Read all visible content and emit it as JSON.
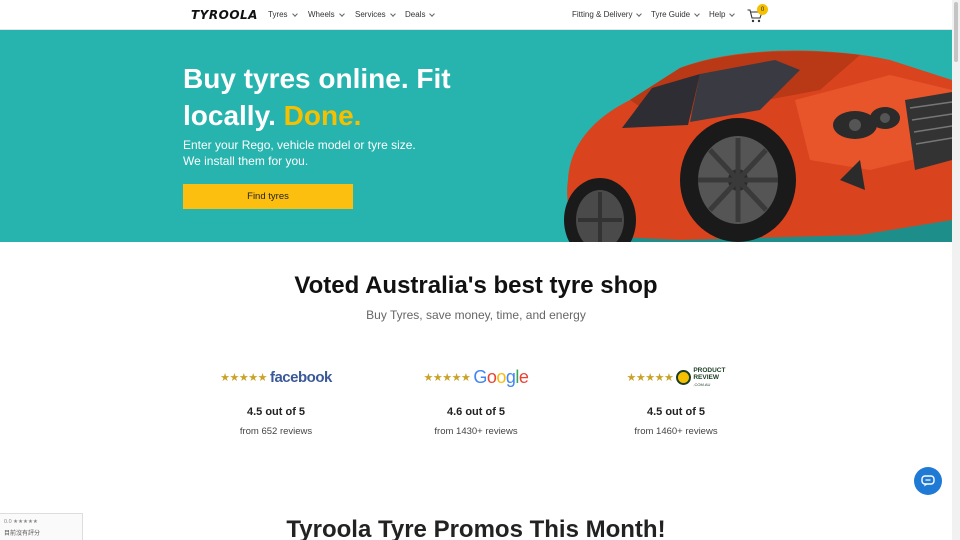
{
  "nav": {
    "logo": "TYROOLA",
    "left_items": [
      "Tyres",
      "Wheels",
      "Services",
      "Deals"
    ],
    "right_items": [
      "Fitting & Delivery",
      "Tyre Guide",
      "Help"
    ],
    "cart_count": "0"
  },
  "hero": {
    "title_line1": "Buy tyres online. Fit",
    "title_line2": "locally.",
    "title_highlight": "Done.",
    "subtitle_line1": "Enter your Rego, vehicle model or tyre size.",
    "subtitle_line2": "We install them for you.",
    "cta": "Find tyres"
  },
  "voted": {
    "title": "Voted Australia's best tyre shop",
    "subtitle": "Buy Tyres, save money, time, and energy"
  },
  "reviews": [
    {
      "platform": "facebook",
      "stars": "★★★★★",
      "score": "4.5 out of 5",
      "count": "from 652 reviews"
    },
    {
      "platform": "Google",
      "stars": "★★★★★",
      "score": "4.6 out of 5",
      "count": "from 1430+ reviews"
    },
    {
      "platform": "PRODUCT REVIEW",
      "platform_small": ".COM.AU",
      "stars": "★★★★★",
      "score": "4.5 out of 5",
      "count": "from 1460+ reviews"
    }
  ],
  "widget": {
    "line1": "0.0 ★★★★★",
    "line2": "目前沒有評分"
  },
  "promos": {
    "title": "Tyroola Tyre Promos This Month!"
  },
  "colors": {
    "hero_bg": "#27b3ae",
    "accent": "#f5c000",
    "button": "#fcbf10",
    "chat": "#1f7ad6",
    "facebook": "#3b5998"
  },
  "icons": [
    "cart-icon",
    "chat-icon",
    "chevron-down-icon",
    "product-review-icon"
  ]
}
